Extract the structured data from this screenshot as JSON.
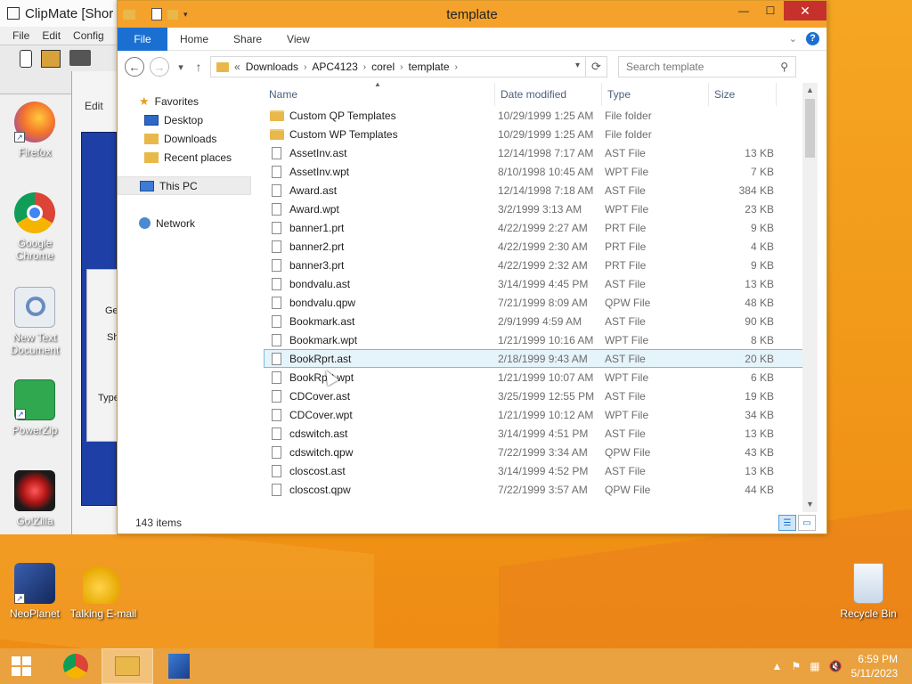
{
  "desktop": {
    "icons": [
      {
        "label": "Firefox",
        "icon": "firefox-icon",
        "color": "#e8572b"
      },
      {
        "label": "Google Chrome",
        "icon": "chrome-icon",
        "color": "#2e8b46"
      },
      {
        "label": "New Text Document",
        "icon": "settings-document-icon",
        "color": "#e8edf2"
      },
      {
        "label": "PowerZip",
        "icon": "zip-folder-icon",
        "color": "#2fa84f"
      },
      {
        "label": "Go!Zilla",
        "icon": "gozilla-eye-icon",
        "color": "#8c1010"
      },
      {
        "label": "NeoPlanet",
        "icon": "neoplanet-icon",
        "color": "#1f3c7a"
      },
      {
        "label": "Talking E-mail",
        "icon": "talking-email-icon",
        "color": "#f6c52b"
      },
      {
        "label": "Recycle Bin",
        "icon": "recycle-bin-icon",
        "color": "#dfe9f3"
      }
    ]
  },
  "clipmate": {
    "title": "ClipMate [Shor",
    "menu": [
      "File",
      "Edit",
      "Config"
    ],
    "inner_menu": "Edit",
    "labels": [
      "Ge",
      "Sh",
      "Type"
    ]
  },
  "window": {
    "title": "template",
    "controls": {
      "minimize": "—",
      "maximize": "☐",
      "close": "✕"
    }
  },
  "ribbon": {
    "tabs": [
      "File",
      "Home",
      "Share",
      "View"
    ]
  },
  "address": {
    "prefix": "«",
    "crumbs": [
      "Downloads",
      "APC4123",
      "corel",
      "template"
    ],
    "search_placeholder": "Search template"
  },
  "nav": {
    "favorites_label": "Favorites",
    "favorites": [
      "Desktop",
      "Downloads",
      "Recent places"
    ],
    "this_pc": "This PC",
    "network": "Network"
  },
  "columns": {
    "name": "Name",
    "date": "Date modified",
    "type": "Type",
    "size": "Size"
  },
  "files": [
    {
      "name": "Custom QP Templates",
      "date": "10/29/1999 1:25 AM",
      "type": "File folder",
      "size": "",
      "folder": true
    },
    {
      "name": "Custom WP Templates",
      "date": "10/29/1999 1:25 AM",
      "type": "File folder",
      "size": "",
      "folder": true
    },
    {
      "name": "AssetInv.ast",
      "date": "12/14/1998 7:17 AM",
      "type": "AST File",
      "size": "13 KB"
    },
    {
      "name": "AssetInv.wpt",
      "date": "8/10/1998 10:45 AM",
      "type": "WPT File",
      "size": "7 KB"
    },
    {
      "name": "Award.ast",
      "date": "12/14/1998 7:18 AM",
      "type": "AST File",
      "size": "384 KB"
    },
    {
      "name": "Award.wpt",
      "date": "3/2/1999 3:13 AM",
      "type": "WPT File",
      "size": "23 KB"
    },
    {
      "name": "banner1.prt",
      "date": "4/22/1999 2:27 AM",
      "type": "PRT File",
      "size": "9 KB"
    },
    {
      "name": "banner2.prt",
      "date": "4/22/1999 2:30 AM",
      "type": "PRT File",
      "size": "4 KB"
    },
    {
      "name": "banner3.prt",
      "date": "4/22/1999 2:32 AM",
      "type": "PRT File",
      "size": "9 KB"
    },
    {
      "name": "bondvalu.ast",
      "date": "3/14/1999 4:45 PM",
      "type": "AST File",
      "size": "13 KB"
    },
    {
      "name": "bondvalu.qpw",
      "date": "7/21/1999 8:09 AM",
      "type": "QPW File",
      "size": "48 KB"
    },
    {
      "name": "Bookmark.ast",
      "date": "2/9/1999 4:59 AM",
      "type": "AST File",
      "size": "90 KB"
    },
    {
      "name": "Bookmark.wpt",
      "date": "1/21/1999 10:16 AM",
      "type": "WPT File",
      "size": "8 KB"
    },
    {
      "name": "BookRprt.ast",
      "date": "2/18/1999 9:43 AM",
      "type": "AST File",
      "size": "20 KB",
      "selected": true
    },
    {
      "name": "BookRprt.wpt",
      "date": "1/21/1999 10:07 AM",
      "type": "WPT File",
      "size": "6 KB"
    },
    {
      "name": "CDCover.ast",
      "date": "3/25/1999 12:55 PM",
      "type": "AST File",
      "size": "19 KB"
    },
    {
      "name": "CDCover.wpt",
      "date": "1/21/1999 10:12 AM",
      "type": "WPT File",
      "size": "34 KB"
    },
    {
      "name": "cdswitch.ast",
      "date": "3/14/1999 4:51 PM",
      "type": "AST File",
      "size": "13 KB"
    },
    {
      "name": "cdswitch.qpw",
      "date": "7/22/1999 3:34 AM",
      "type": "QPW File",
      "size": "43 KB"
    },
    {
      "name": "closcost.ast",
      "date": "3/14/1999 4:52 PM",
      "type": "AST File",
      "size": "13 KB"
    },
    {
      "name": "closcost.qpw",
      "date": "7/22/1999 3:57 AM",
      "type": "QPW File",
      "size": "44 KB"
    }
  ],
  "status": {
    "items_count": "143 items"
  },
  "taskbar": {
    "time": "6:59 PM",
    "date": "5/11/2023",
    "accent": "#e9a23f"
  }
}
